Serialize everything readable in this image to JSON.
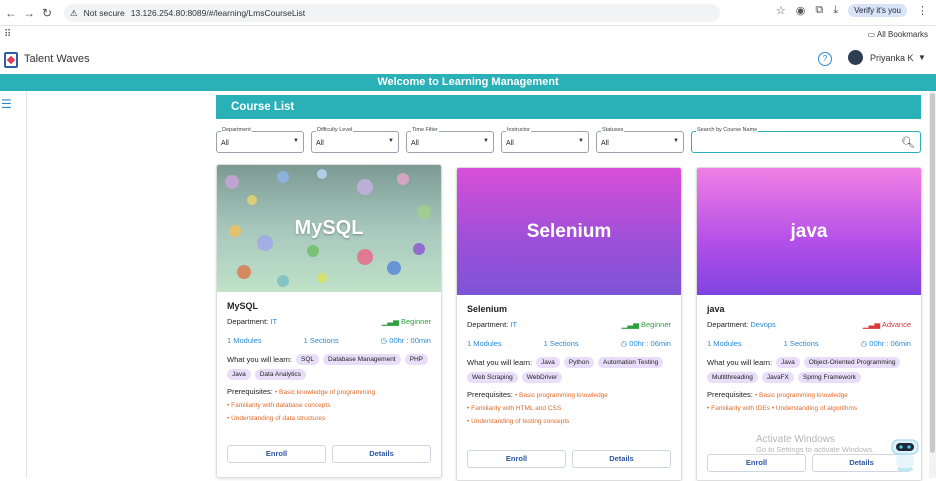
{
  "browser": {
    "not_secure": "Not secure",
    "url": "13.126.254.80:8089/#/learning/LmsCourseList",
    "verify": "Verify it's you",
    "all_bookmarks": "All Bookmarks"
  },
  "header": {
    "brand": "Talent Waves",
    "user": "Priyanka K"
  },
  "banner": "Welcome to Learning Management",
  "course_list_title": "Course List",
  "filters": [
    {
      "label": "Department",
      "value": "All"
    },
    {
      "label": "Difficulty Level",
      "value": "All"
    },
    {
      "label": "Time Filter",
      "value": "All"
    },
    {
      "label": "Instructor",
      "value": "All"
    },
    {
      "label": "Statuses",
      "value": "All"
    }
  ],
  "search": {
    "label": "Search by Course Name"
  },
  "cards": [
    {
      "hero": "MySQL",
      "title": "MySQL",
      "department_label": "Department:",
      "department": "IT",
      "level": "Beginner",
      "modules": "1 Modules",
      "sections": "1 Sections",
      "duration": "00hr : 00min",
      "learn_label": "What you will learn:",
      "tags": [
        "SQL",
        "Database Management",
        "PHP",
        "Java",
        "Data Analytics"
      ],
      "prereq_label": "Prerequisites:",
      "prereq": [
        "Basic knowledge of programming",
        "Familiarity with database concepts",
        "Understanding of data structures"
      ],
      "enroll": "Enroll",
      "details": "Details"
    },
    {
      "hero": "Selenium",
      "title": "Selenium",
      "department_label": "Department:",
      "department": "IT",
      "level": "Beginner",
      "modules": "1 Modules",
      "sections": "1 Sections",
      "duration": "00hr : 06min",
      "learn_label": "What you will learn:",
      "tags": [
        "Java",
        "Python",
        "Automation Testing",
        "Web Scraping",
        "WebDriver"
      ],
      "prereq_label": "Prerequisites:",
      "prereq": [
        "Basic programming knowledge",
        "Familiarity with HTML and CSS",
        "Understanding of testing concepts"
      ],
      "enroll": "Enroll",
      "details": "Details"
    },
    {
      "hero": "java",
      "title": "java",
      "department_label": "Department:",
      "department": "Devops",
      "level": "Advance",
      "modules": "1 Modules",
      "sections": "1 Sections",
      "duration": "00hr : 06min",
      "learn_label": "What you will learn:",
      "tags": [
        "Java",
        "Object-Oriented Programming",
        "Multithreading",
        "JavaFX",
        "Spring Framework"
      ],
      "prereq_label": "Prerequisites:",
      "prereq": [
        "Basic programming knowledge",
        "Familiarity with IDEs",
        "Understanding of algorithms"
      ],
      "enroll": "Enroll",
      "details": "Details"
    }
  ],
  "watermark": {
    "title": "Activate Windows",
    "sub": "Go to Settings to activate Windows."
  },
  "colors": {
    "teal": "#2ab0b7",
    "link": "#2a8bd3",
    "beginner": "#2e9f3e",
    "advance": "#d63a3a",
    "prereq": "#e06a2a"
  }
}
